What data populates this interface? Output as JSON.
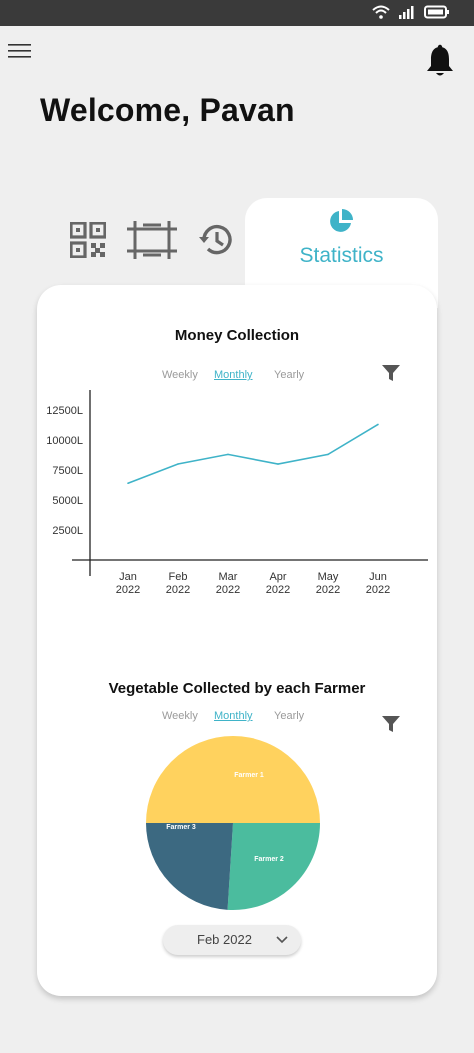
{
  "header": {
    "greeting": "Welcome, Pavan"
  },
  "icons": {
    "menu": "hamburger-menu-icon",
    "notifications": "bell-icon",
    "wifi": "wifi-icon",
    "signal": "signal-icon",
    "battery": "battery-icon",
    "tab_qr": "qr-code-icon",
    "tab_scan": "scan-frame-icon",
    "tab_history": "history-icon",
    "tab_stats": "pie-chart-icon",
    "filter": "filter-icon",
    "dropdown": "chevron-down-icon"
  },
  "tabs": {
    "active_label": "Statistics"
  },
  "colors": {
    "accent": "#3fb3c8",
    "farmer1": "#ffd25e",
    "farmer2": "#4bbc9e",
    "farmer3": "#3c6981"
  },
  "money_chart": {
    "period_options": [
      "Weekly",
      "Monthly",
      "Yearly"
    ],
    "selected_period": "Monthly"
  },
  "veg_chart": {
    "period_options": [
      "Weekly",
      "Monthly",
      "Yearly"
    ],
    "selected_period": "Monthly",
    "month_select": "Feb 2022"
  },
  "chart_data": [
    {
      "type": "line",
      "title": "Money Collection",
      "x": [
        [
          "Jan",
          "2022"
        ],
        [
          "Feb",
          "2022"
        ],
        [
          "Mar",
          "2022"
        ],
        [
          "Apr",
          "2022"
        ],
        [
          "May",
          "2022"
        ],
        [
          "Jun",
          "2022"
        ]
      ],
      "y_ticks": [
        2500,
        5000,
        7500,
        10000,
        12500
      ],
      "y_tick_labels": [
        "2500L",
        "5000L",
        "7500L",
        "10000L",
        "12500L"
      ],
      "values": [
        6400,
        8000,
        8800,
        8000,
        8800,
        11300
      ],
      "ylim": [
        0,
        14400
      ],
      "grid": false,
      "color": "#3fb3c8"
    },
    {
      "type": "pie",
      "title": "Vegetable Collected by each Farmer",
      "labels": [
        "Farmer 1",
        "Farmer 2",
        "Farmer 3"
      ],
      "values": [
        50,
        26,
        24
      ],
      "colors": [
        "#ffd25e",
        "#4bbc9e",
        "#3c6981"
      ]
    }
  ]
}
